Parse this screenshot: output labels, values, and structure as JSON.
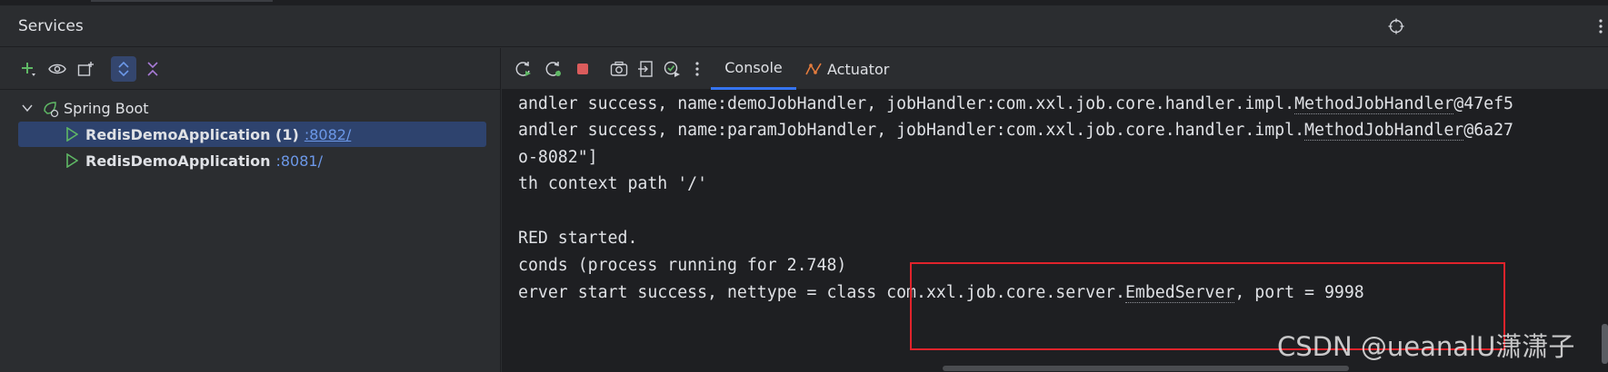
{
  "header": {
    "title": "Services"
  },
  "left_toolbar": {
    "icons": [
      "add-icon",
      "eye-icon",
      "new-group-icon",
      "expand-collapse-icon",
      "collapse-all-icon"
    ]
  },
  "tree": {
    "group_label": "Spring Boot",
    "items": [
      {
        "name": "RedisDemoApplication (1)",
        "port": ":8082/",
        "selected": true
      },
      {
        "name": "RedisDemoApplication",
        "port": ":8081/",
        "selected": false
      }
    ]
  },
  "right_toolbar": {
    "icons": [
      "rerun-icon",
      "restart-debug-icon",
      "stop-icon",
      "screenshot-icon",
      "export-icon",
      "debug-attach-icon",
      "more-icon"
    ]
  },
  "tabs": [
    {
      "label": "Console",
      "selected": true
    },
    {
      "label": "Actuator",
      "selected": false
    }
  ],
  "console": {
    "lines": [
      {
        "pre": "andler success, name:demoJobHandler, jobHandler:com.xxl.job.core.handler.impl.",
        "link": "MethodJobHandler",
        "post": "@47ef5"
      },
      {
        "pre": "andler success, name:paramJobHandler, jobHandler:com.xxl.job.core.handler.impl.",
        "link": "MethodJobHandler",
        "post": "@6a27"
      },
      {
        "pre": "o-8082\"]",
        "link": "",
        "post": ""
      },
      {
        "pre": "th context path '/'",
        "link": "",
        "post": ""
      },
      {
        "pre": "",
        "link": "",
        "post": ""
      },
      {
        "pre": "RED started.",
        "link": "",
        "post": ""
      },
      {
        "pre": "conds (process running for 2.748)",
        "link": "",
        "post": ""
      },
      {
        "pre": "erver start success, nettype = class com.xxl.job.core.server.",
        "link": "EmbedServer",
        "post": ", port = 9998"
      }
    ]
  },
  "watermark": "CSDN @ueanalU潇潇子",
  "colors": {
    "accent_blue": "#3574f0",
    "selection": "#2e436e",
    "highlight_red": "#e0232b",
    "run_green": "#5fb865",
    "stop_red": "#db5c5c"
  }
}
